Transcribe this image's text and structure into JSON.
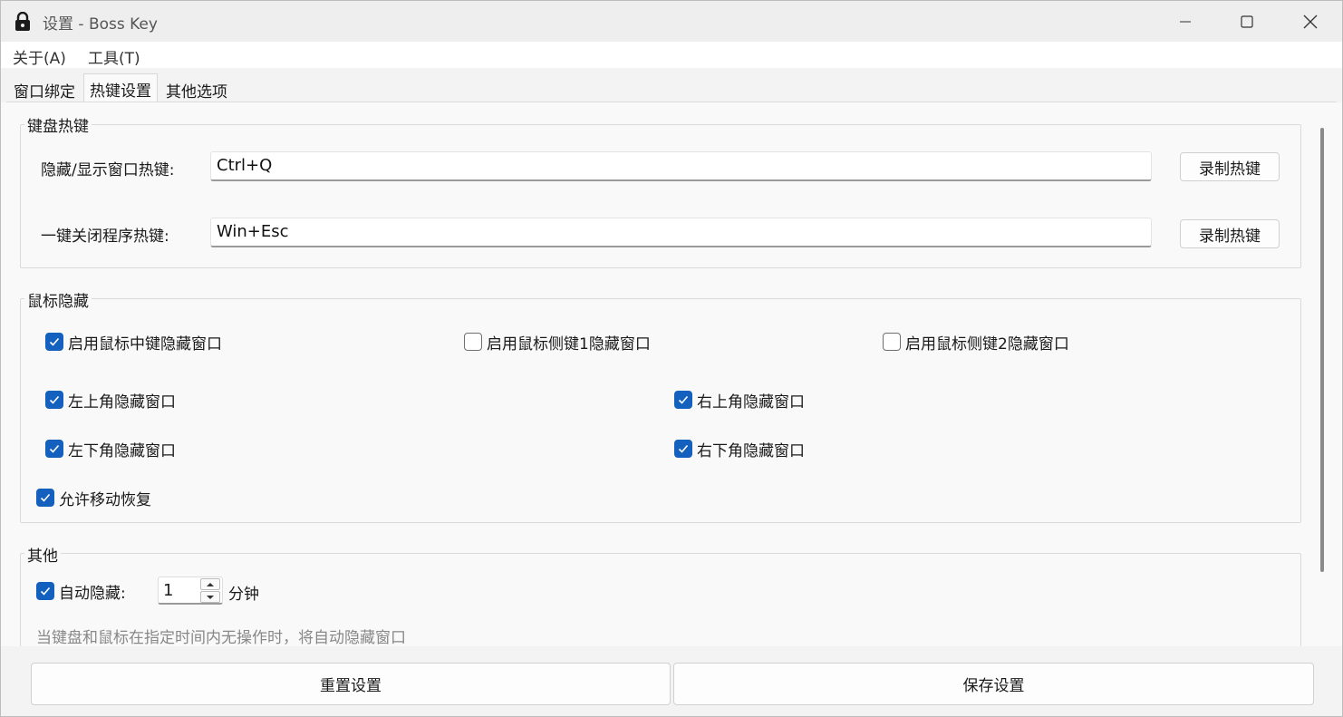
{
  "window": {
    "title": "设置 - Boss Key",
    "icon": "lock-icon",
    "controls": [
      "minimize-icon",
      "maximize-icon",
      "close-icon"
    ]
  },
  "menu": {
    "items": [
      {
        "label": "关于(A)"
      },
      {
        "label": "工具(T)"
      }
    ]
  },
  "tabs": [
    {
      "label": "窗口绑定",
      "active": false
    },
    {
      "label": "热键设置",
      "active": true
    },
    {
      "label": "其他选项",
      "active": false
    }
  ],
  "keyboard": {
    "title": "键盘热键",
    "rows": [
      {
        "label": "隐藏/显示窗口热键:",
        "value": "Ctrl+Q",
        "button": "录制热键"
      },
      {
        "label": "一键关闭程序热键:",
        "value": "Win+Esc",
        "button": "录制热键"
      }
    ]
  },
  "mouse": {
    "title": "鼠标隐藏",
    "options": [
      {
        "label": "启用鼠标中键隐藏窗口",
        "checked": true
      },
      {
        "label": "启用鼠标侧键1隐藏窗口",
        "checked": false
      },
      {
        "label": "启用鼠标侧键2隐藏窗口",
        "checked": false
      },
      {
        "label": "左上角隐藏窗口",
        "checked": true
      },
      {
        "label": "右上角隐藏窗口",
        "checked": true
      },
      {
        "label": "左下角隐藏窗口",
        "checked": true
      },
      {
        "label": "右下角隐藏窗口",
        "checked": true
      },
      {
        "label": "允许移动恢复",
        "checked": true
      }
    ]
  },
  "other": {
    "title": "其他",
    "auto_hide_label": "自动隐藏:",
    "auto_hide_checked": true,
    "minutes_value": "1",
    "unit": "分钟",
    "hint": "当键盘和鼠标在指定时间内无操作时，将自动隐藏窗口"
  },
  "footer": {
    "reset_label": "重置设置",
    "save_label": "保存设置"
  },
  "colors": {
    "accent": "#1460bf",
    "window_bg": "#f9f9f9"
  }
}
